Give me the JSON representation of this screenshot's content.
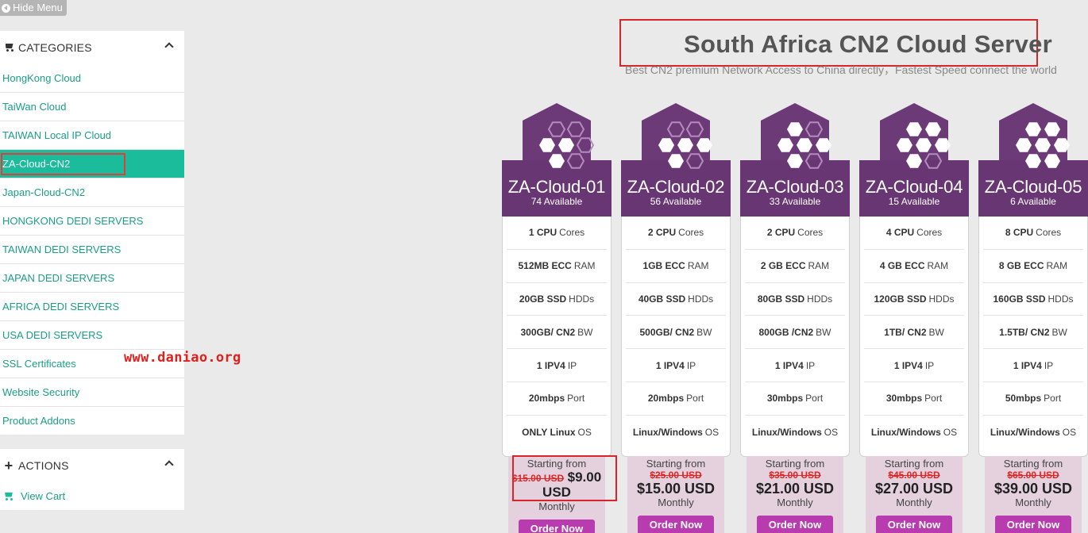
{
  "hide_menu_label": "Hide Menu",
  "sidebar": {
    "categories_title": "CATEGORIES",
    "items": [
      {
        "label": "HongKong Cloud"
      },
      {
        "label": "TaiWan Cloud"
      },
      {
        "label": "TAIWAN Local IP Cloud"
      },
      {
        "label": "ZA-Cloud-CN2"
      },
      {
        "label": "Japan-Cloud-CN2"
      },
      {
        "label": "HONGKONG DEDI SERVERS"
      },
      {
        "label": "TAIWAN DEDI SERVERS"
      },
      {
        "label": "JAPAN DEDI SERVERS"
      },
      {
        "label": "AFRICA DEDI SERVERS"
      },
      {
        "label": "USA DEDI SERVERS"
      },
      {
        "label": "SSL Certificates"
      },
      {
        "label": "Website Security"
      },
      {
        "label": "Product Addons"
      }
    ],
    "actions_title": "ACTIONS",
    "view_cart": "View Cart"
  },
  "watermark": "www.daniao.org",
  "header": {
    "title": "South Africa CN2 Cloud Server",
    "subtitle": "Best CN2 premium Network Access to China directly，Fastest Speed connect the world"
  },
  "colors": {
    "accent": "#1abc9c",
    "card_purple": "#6d3a78",
    "order_button": "#b83bb0",
    "highlight_red": "#d9252a"
  },
  "plans": [
    {
      "name": "ZA-Cloud-01",
      "available": "74 Available",
      "features": [
        {
          "bold": "1 CPU",
          "rest": "Cores"
        },
        {
          "bold": "512MB ECC",
          "rest": "RAM"
        },
        {
          "bold": "20GB SSD",
          "rest": "HDDs"
        },
        {
          "bold": "300GB/ CN2",
          "rest": "BW"
        },
        {
          "bold": "1 IPV4",
          "rest": "IP"
        },
        {
          "bold": "20mbps",
          "rest": "Port"
        },
        {
          "bold": "ONLY Linux",
          "rest": "OS"
        }
      ],
      "starting": "Starting from",
      "old_price": "$15.00 USD",
      "price_amount": "$9.00",
      "price_currency": "USD",
      "period": "Monthly",
      "order": "Order Now"
    },
    {
      "name": "ZA-Cloud-02",
      "available": "56 Available",
      "features": [
        {
          "bold": "2 CPU",
          "rest": "Cores"
        },
        {
          "bold": "1GB ECC",
          "rest": "RAM"
        },
        {
          "bold": "40GB SSD",
          "rest": "HDDs"
        },
        {
          "bold": "500GB/ CN2",
          "rest": "BW"
        },
        {
          "bold": "1 IPV4",
          "rest": "IP"
        },
        {
          "bold": "20mbps",
          "rest": "Port"
        },
        {
          "bold": "Linux/Windows",
          "rest": "OS"
        }
      ],
      "starting": "Starting from",
      "old_price": "$25.00 USD",
      "price": "$15.00 USD",
      "period": "Monthly",
      "order": "Order Now"
    },
    {
      "name": "ZA-Cloud-03",
      "available": "33 Available",
      "features": [
        {
          "bold": "2 CPU",
          "rest": "Cores"
        },
        {
          "bold": "2 GB ECC",
          "rest": "RAM"
        },
        {
          "bold": "80GB SSD",
          "rest": "HDDs"
        },
        {
          "bold": "800GB /CN2",
          "rest": "BW"
        },
        {
          "bold": "1 IPV4",
          "rest": "IP"
        },
        {
          "bold": "30mbps",
          "rest": "Port"
        },
        {
          "bold": "Linux/Windows",
          "rest": "OS"
        }
      ],
      "starting": "Starting from",
      "old_price": "$35.00 USD",
      "price": "$21.00 USD",
      "period": "Monthly",
      "order": "Order Now"
    },
    {
      "name": "ZA-Cloud-04",
      "available": "15 Available",
      "features": [
        {
          "bold": "4 CPU",
          "rest": "Cores"
        },
        {
          "bold": "4 GB ECC",
          "rest": "RAM"
        },
        {
          "bold": "120GB SSD",
          "rest": "HDDs"
        },
        {
          "bold": "1TB/ CN2",
          "rest": "BW"
        },
        {
          "bold": "1 IPV4",
          "rest": "IP"
        },
        {
          "bold": "30mbps",
          "rest": "Port"
        },
        {
          "bold": "Linux/Windows",
          "rest": "OS"
        }
      ],
      "starting": "Starting from",
      "old_price": "$45.00 USD",
      "price": "$27.00 USD",
      "period": "Monthly",
      "order": "Order Now"
    },
    {
      "name": "ZA-Cloud-05",
      "available": "6 Available",
      "features": [
        {
          "bold": "8 CPU",
          "rest": "Cores"
        },
        {
          "bold": "8 GB ECC",
          "rest": "RAM"
        },
        {
          "bold": "160GB SSD",
          "rest": "HDDs"
        },
        {
          "bold": "1.5TB/ CN2",
          "rest": "BW"
        },
        {
          "bold": "1 IPV4",
          "rest": "IP"
        },
        {
          "bold": "50mbps",
          "rest": "Port"
        },
        {
          "bold": "Linux/Windows",
          "rest": "OS"
        }
      ],
      "starting": "Starting from",
      "old_price": "$65.00 USD",
      "price": "$39.00 USD",
      "period": "Monthly",
      "order": "Order Now"
    }
  ]
}
